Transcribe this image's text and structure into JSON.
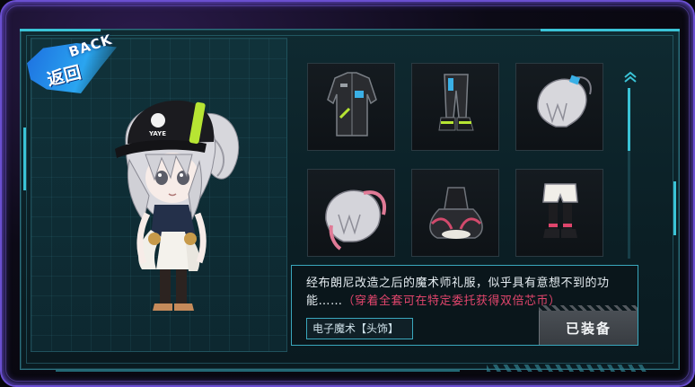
{
  "back_button": {
    "zh_label": "返回",
    "en_label": "BACK"
  },
  "items": [
    {
      "id": "slot-1",
      "icon": "jacket-icon"
    },
    {
      "id": "slot-2",
      "icon": "pants-boots-icon"
    },
    {
      "id": "slot-3",
      "icon": "hair-icon"
    },
    {
      "id": "slot-4",
      "icon": "pink-hair-icon"
    },
    {
      "id": "slot-5",
      "icon": "dress-icon"
    },
    {
      "id": "slot-6",
      "icon": "shorts-boots-icon"
    }
  ],
  "description": {
    "main": "经布朗尼改造之后的魔术师礼服，似乎具有意想不到的功能……",
    "hint": "（穿着全套可在特定委托获得双倍芯币）",
    "tag": "电子魔术【头饰】"
  },
  "equip_button": {
    "label": "已装备"
  },
  "character": {
    "cap_text": "YAYE"
  },
  "colors": {
    "accent": "#3ac3d6",
    "frame": "#6a4fd0",
    "hint": "#e0456c",
    "cap_green": "#b7e533"
  }
}
